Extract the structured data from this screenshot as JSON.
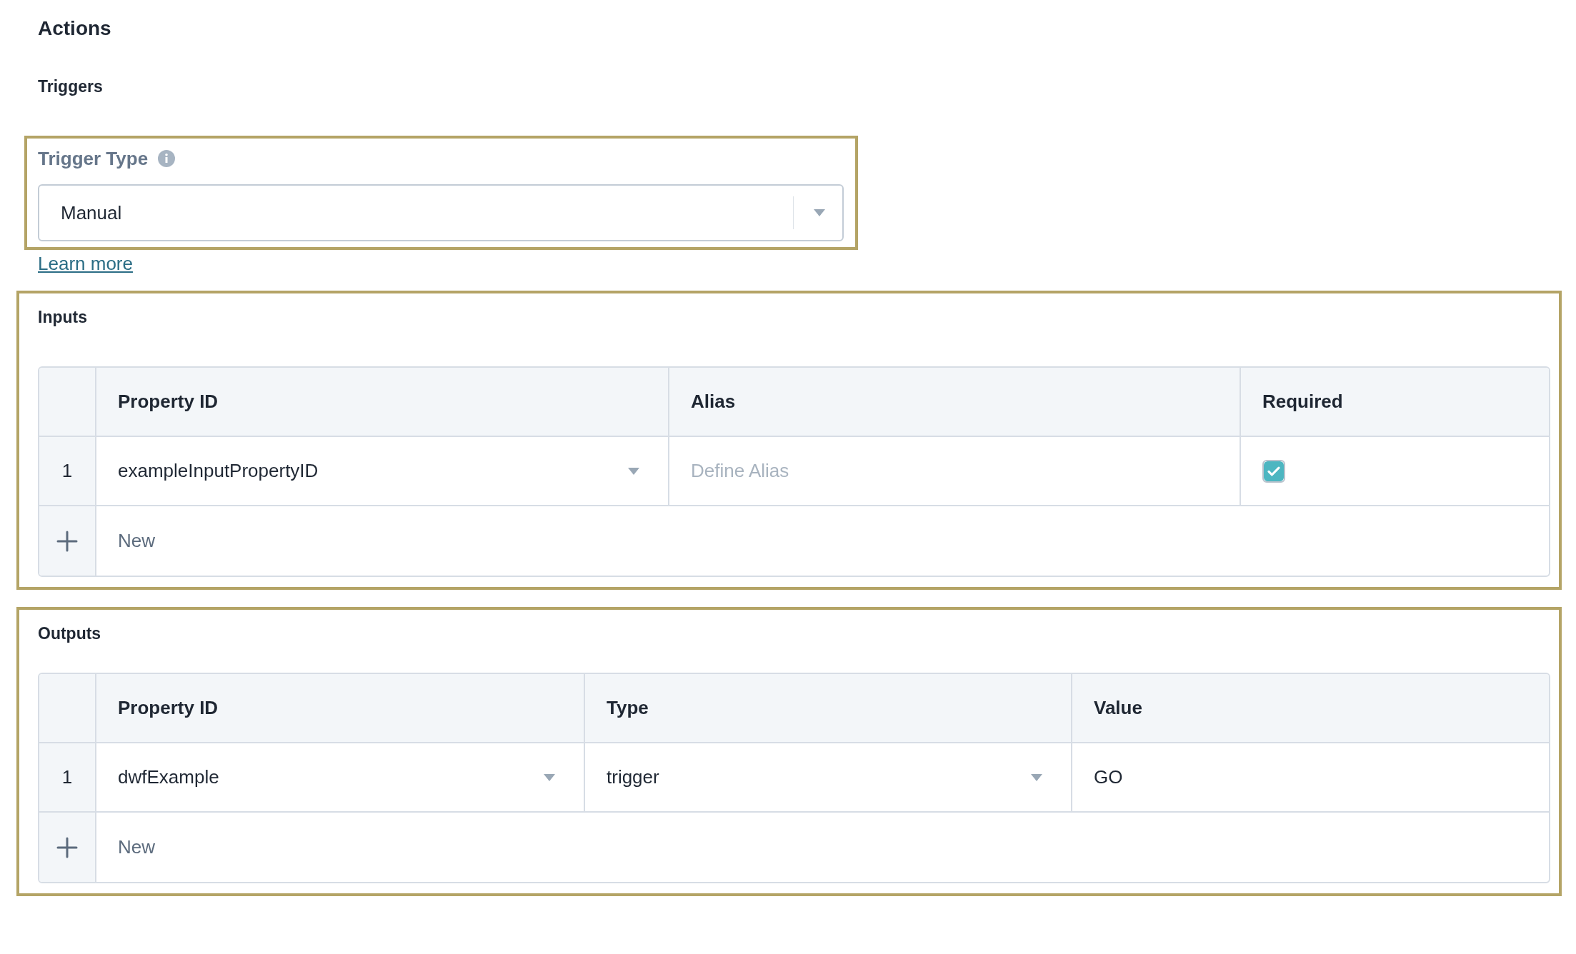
{
  "title": "Actions",
  "triggers": {
    "heading": "Triggers",
    "trigger_type": {
      "label": "Trigger Type",
      "value": "Manual"
    },
    "learn_more": "Learn more"
  },
  "inputs": {
    "heading": "Inputs",
    "columns": [
      "Property ID",
      "Alias",
      "Required"
    ],
    "rows": [
      {
        "number": "1",
        "cells": [
          {
            "kind": "select",
            "value": "exampleInputPropertyID"
          },
          {
            "kind": "field",
            "placeholder": "Define Alias"
          },
          {
            "kind": "checkbox",
            "checked": true
          }
        ]
      }
    ],
    "add_row": {
      "label": "New"
    }
  },
  "outputs": {
    "heading": "Outputs",
    "columns": [
      "Property ID",
      "Type",
      "Value"
    ],
    "rows": [
      {
        "number": "1",
        "cells": [
          {
            "kind": "select",
            "value": "dwfExample"
          },
          {
            "kind": "select",
            "value": "trigger"
          },
          {
            "kind": "text",
            "value": "GO"
          }
        ]
      }
    ],
    "add_row": {
      "label": "New"
    }
  }
}
